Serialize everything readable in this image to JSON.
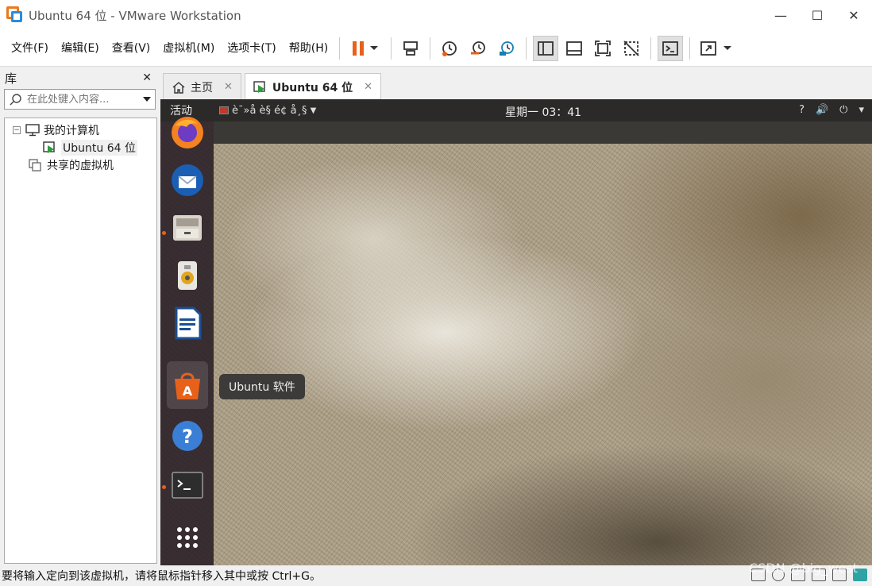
{
  "window": {
    "title": "Ubuntu 64 位 - VMware Workstation",
    "controls": {
      "minimize": "—",
      "maximize": "☐",
      "close": "✕"
    }
  },
  "menu": {
    "items": [
      "文件(F)",
      "编辑(E)",
      "查看(V)",
      "虚拟机(M)",
      "选项卡(T)",
      "帮助(H)"
    ]
  },
  "library": {
    "title": "库",
    "close": "✕",
    "search_placeholder": "在此处键入内容...",
    "tree": {
      "root": "我的计算机",
      "vm": "Ubuntu 64 位",
      "shared": "共享的虚拟机",
      "expander": "−"
    }
  },
  "tabs": [
    {
      "label": "主页",
      "close": "✕"
    },
    {
      "label": "Ubuntu 64 位",
      "close": "✕"
    }
  ],
  "vm_screen": {
    "activities": "活动",
    "app_menu": "è¯»å è§ é¢ å¸§",
    "clock": "星期一 03：41",
    "tray": [
      "?",
      "🔊",
      "⏻",
      "▾"
    ],
    "tooltip": "Ubuntu 软件",
    "dock_icons": [
      "firefox-icon",
      "thunderbird-icon",
      "files-icon",
      "rhythmbox-icon",
      "libreoffice-writer-icon",
      "ubuntu-software-icon",
      "help-icon",
      "terminal-icon",
      "show-apps-icon"
    ]
  },
  "status": {
    "text": "要将输入定向到该虚拟机，请将鼠标指针移入其中或按 Ctrl+G。"
  },
  "watermark": "CSDN @big_west",
  "colors": {
    "accent_orange": "#e8611a",
    "vmware_blue": "#2c8bd8"
  }
}
